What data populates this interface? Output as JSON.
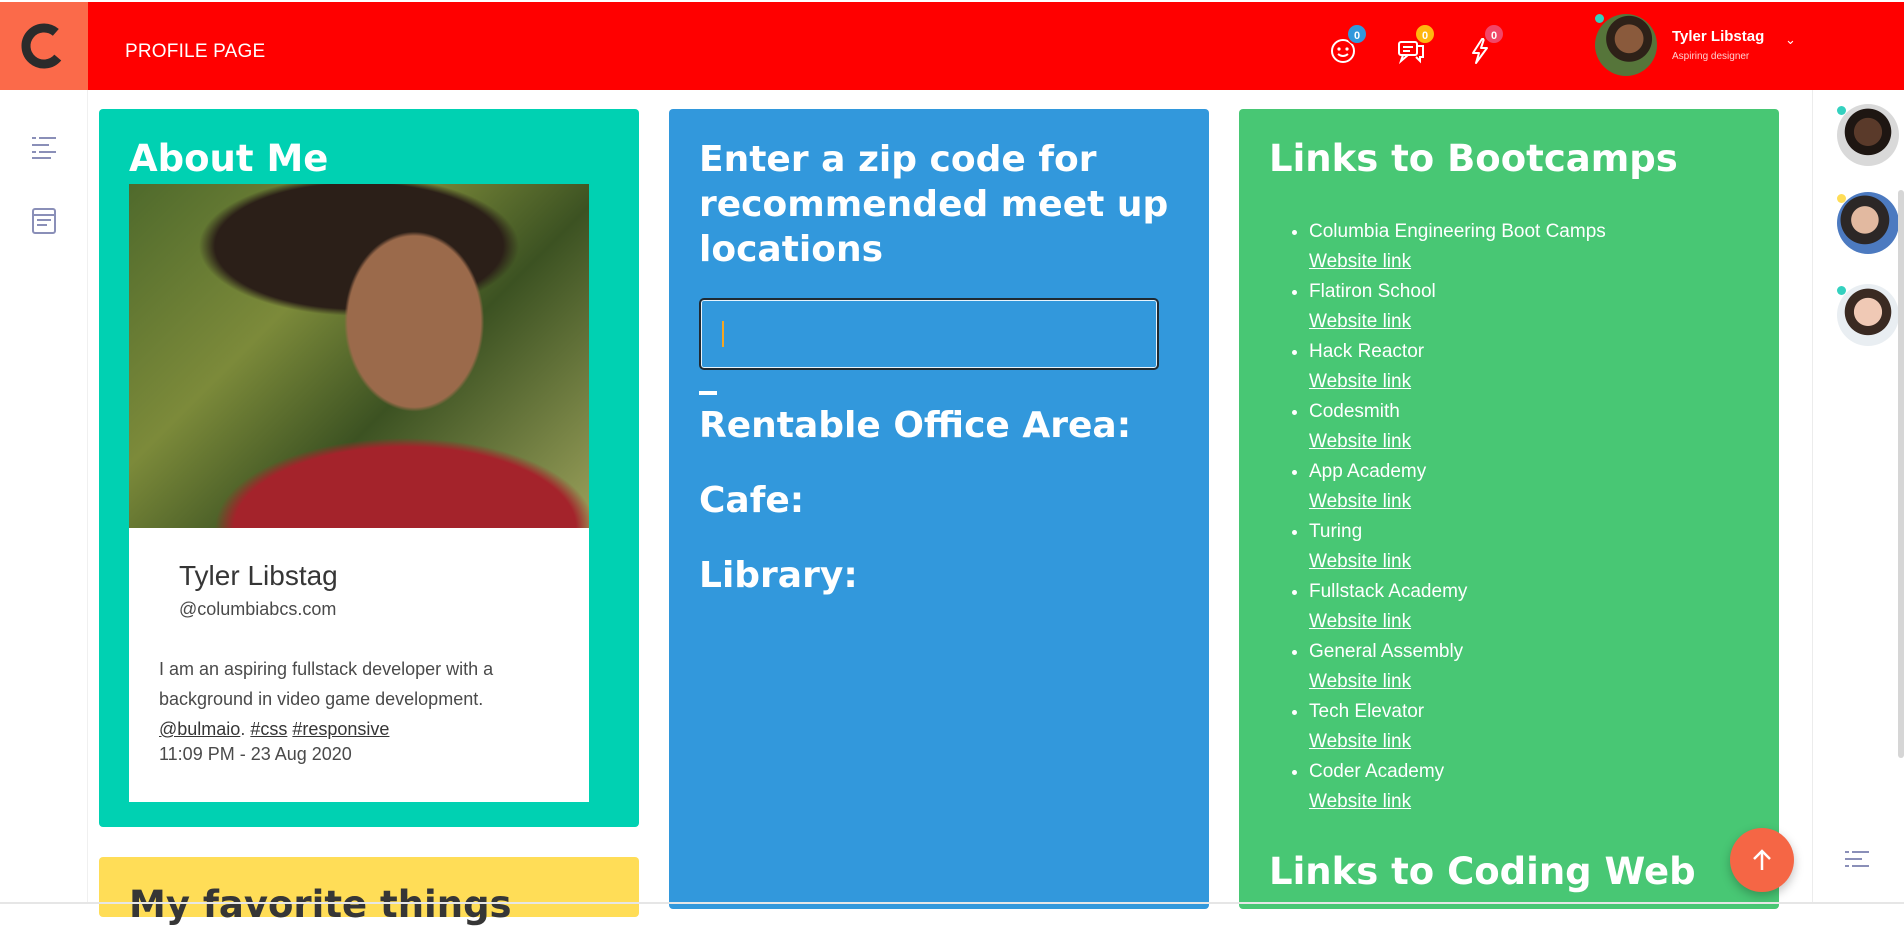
{
  "header": {
    "page_title": "PROFILE PAGE",
    "badges": [
      {
        "icon": "smiley-icon",
        "count": "0",
        "color": "#3298dc"
      },
      {
        "icon": "chat-icon",
        "count": "0",
        "color": "#ffb70f"
      },
      {
        "icon": "lightning-icon",
        "count": "0",
        "color": "#f14668"
      }
    ],
    "user": {
      "name": "Tyler Libstag",
      "subtitle": "Aspiring designer"
    }
  },
  "about": {
    "title": "About Me",
    "name": "Tyler Libstag",
    "handle": "@columbiabcs.com",
    "bio": "I am an aspiring fullstack developer with a background in video game development.",
    "tags": [
      "@bulmaio",
      "#css",
      "#responsive"
    ],
    "tag_separator": ".",
    "timestamp": "11:09 PM - 23 Aug 2020"
  },
  "zip": {
    "title": "Enter a zip code for recommended meet up locations",
    "input_value": "",
    "results": [
      "Rentable Office Area:",
      "Cafe:",
      "Library:"
    ]
  },
  "bootcamps": {
    "title": "Links to Bootcamps",
    "link_label": "Website link",
    "items": [
      "Columbia Engineering Boot Camps",
      "Flatiron School",
      "Hack Reactor",
      "Codesmith",
      "App Academy",
      "Turing",
      "Fullstack Academy",
      "General Assembly",
      "Tech Elevator",
      "Coder Academy"
    ],
    "next_title": "Links to Coding Web"
  },
  "favorites": {
    "title": "My favorite things"
  },
  "colors": {
    "navbar": "#ff0000",
    "logo_bg": "#fb6a4a",
    "about_card": "#00d1b2",
    "zip_card": "#3298dc",
    "links_card": "#48c774",
    "fav_card": "#ffdd57",
    "fab": "#f56645"
  }
}
